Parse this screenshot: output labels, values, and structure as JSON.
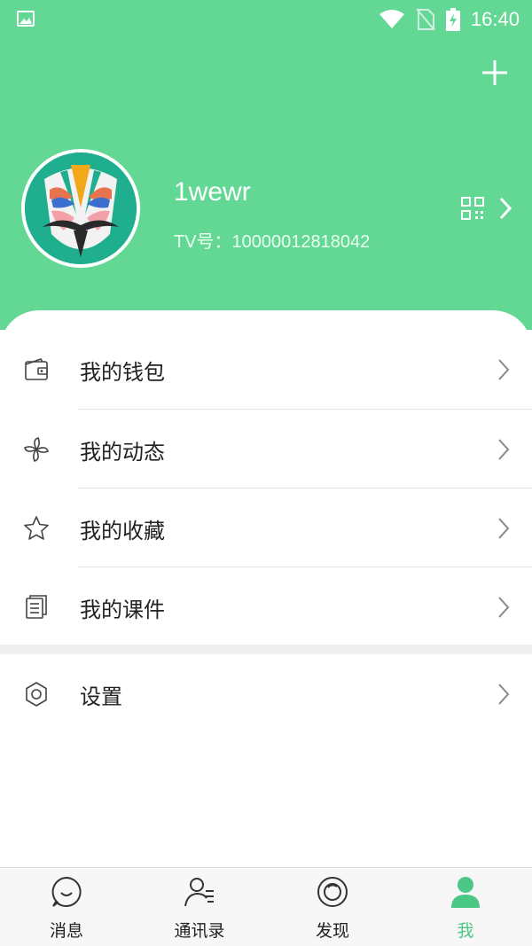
{
  "status_bar": {
    "time": "16:40"
  },
  "profile": {
    "username": "1wewr",
    "tv_id": "TV号：10000012818042"
  },
  "menu": [
    {
      "label": "我的钱包",
      "icon": "wallet-icon"
    },
    {
      "label": "我的动态",
      "icon": "pinwheel-icon"
    },
    {
      "label": "我的收藏",
      "icon": "star-icon"
    },
    {
      "label": "我的课件",
      "icon": "document-icon"
    }
  ],
  "settings": {
    "label": "设置",
    "icon": "hexagon-settings-icon"
  },
  "tabbar": [
    {
      "label": "消息",
      "icon": "chat-bubble-icon"
    },
    {
      "label": "通讯录",
      "icon": "contacts-icon"
    },
    {
      "label": "发现",
      "icon": "discover-icon"
    },
    {
      "label": "我",
      "icon": "person-icon",
      "active": true
    }
  ],
  "colors": {
    "accent": "#63d895",
    "active_tab": "#4cc886"
  }
}
